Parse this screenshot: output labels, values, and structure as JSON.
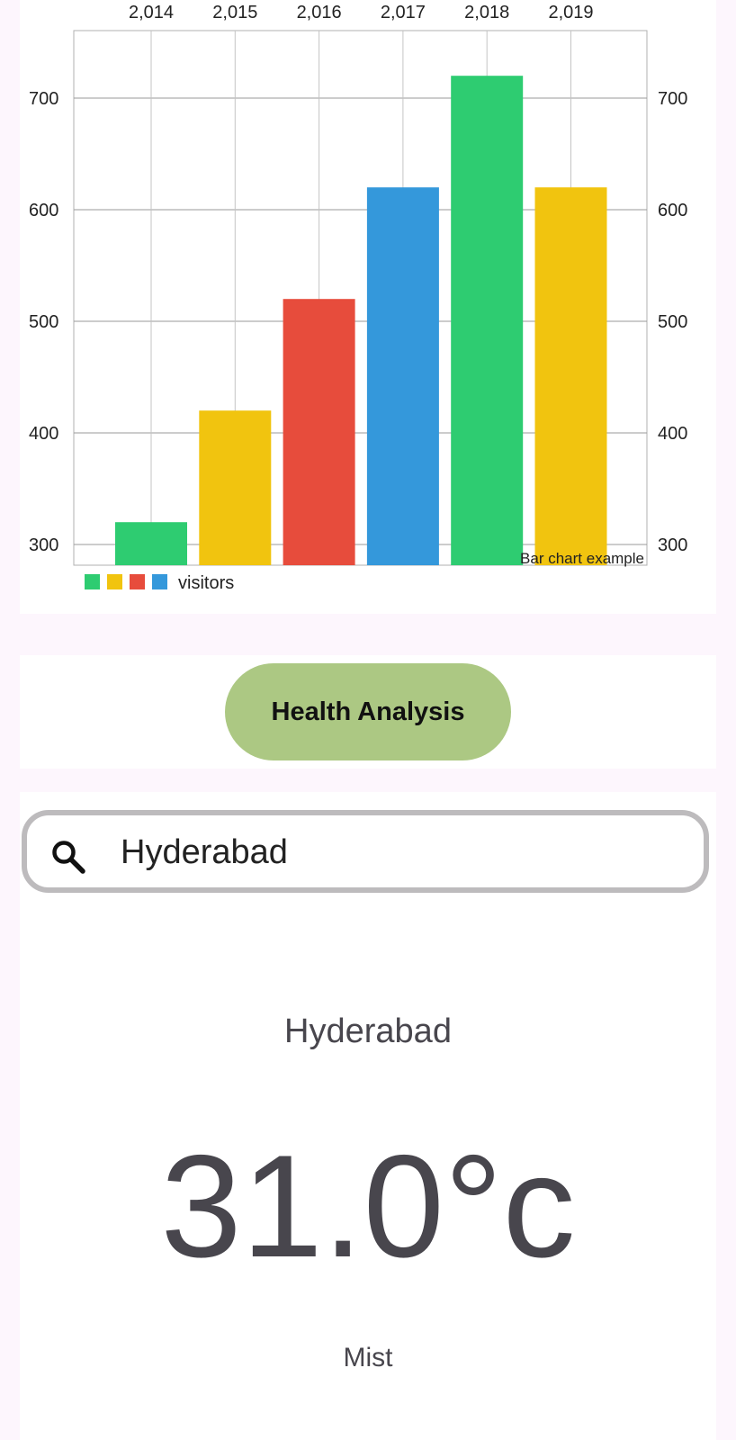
{
  "chart_data": {
    "type": "bar",
    "categories": [
      "2,014",
      "2,015",
      "2,016",
      "2,017",
      "2,018",
      "2,019"
    ],
    "values": [
      320,
      420,
      520,
      620,
      720,
      620
    ],
    "colors": [
      "#2ecc71",
      "#f1c40f",
      "#e74c3c",
      "#3498db",
      "#2ecc71",
      "#f1c40f"
    ],
    "yticks": [
      300,
      400,
      500,
      600,
      700
    ],
    "ylim": [
      280,
      760
    ],
    "legend": {
      "label": "visitors",
      "colors": [
        "#2ecc71",
        "#f1c40f",
        "#e74c3c",
        "#3498db"
      ]
    },
    "description": "Bar chart example",
    "grid": true
  },
  "health_button": {
    "label": "Health Analysis"
  },
  "search": {
    "value": "Hyderabad",
    "icon": "search-icon"
  },
  "weather": {
    "city": "Hyderabad",
    "temperature": "31.0°c",
    "condition": "Mist"
  },
  "colors": {
    "button_bg": "#acc883",
    "search_border": "#bdbbbd",
    "text": "#48464d",
    "page_bg": "#fdf6fd"
  }
}
